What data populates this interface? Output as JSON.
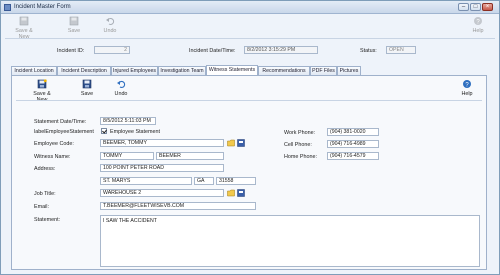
{
  "window": {
    "title": "Incident Master Form"
  },
  "top_toolbar": {
    "save_new": "Save & New",
    "save": "Save",
    "undo": "Undo",
    "help": "Help"
  },
  "header": {
    "incident_id_label": "Incident ID:",
    "incident_id_value": "2",
    "incident_datetime_label": "Incident Date/Time:",
    "incident_datetime_value": "8/2/2012 3:15:29 PM",
    "status_label": "Status:",
    "status_value": "OPEN"
  },
  "tabs": [
    "Incident Location",
    "Incident Description",
    "Injured Employees",
    "Investigation Team",
    "Witness Statements",
    "Recommendations",
    "PDF Files",
    "Pictures"
  ],
  "inner_toolbar": {
    "save_new": "Save & New",
    "save": "Save",
    "undo": "Undo",
    "help": "Help"
  },
  "form": {
    "statement_datetime_label": "Statement Date/Time:",
    "statement_datetime_value": "8/5/2012 5:11:03 PM",
    "is_employee_label": "labelEmployeeStatement",
    "employee_statement_checkbox_label": "Employee Statement",
    "employee_code_label": "Employee Code:",
    "employee_code_value": "BEEMER, TOMMY",
    "witness_name_label": "Witness Name:",
    "witness_first": "TOMMY",
    "witness_last": "BEEMER",
    "address_label": "Address:",
    "address_line": "100 POINT PETER ROAD",
    "city": "ST. MARYS",
    "state": "GA",
    "zip": "31558",
    "job_title_label": "Job Title:",
    "job_title_value": "WAREHOUSE 2",
    "email_label": "Email:",
    "email_value": "T.BEEMER@FLEETWISEVB.COM",
    "statement_label": "Statement:",
    "statement_value": "I SAW THE ACCIDENT",
    "work_phone_label": "Work Phone:",
    "work_phone_value": "(904) 381-0020",
    "cell_phone_label": "Cell Phone:",
    "cell_phone_value": "(904) 716-4989",
    "home_phone_label": "Home Phone:",
    "home_phone_value": "(904) 716-4579"
  }
}
